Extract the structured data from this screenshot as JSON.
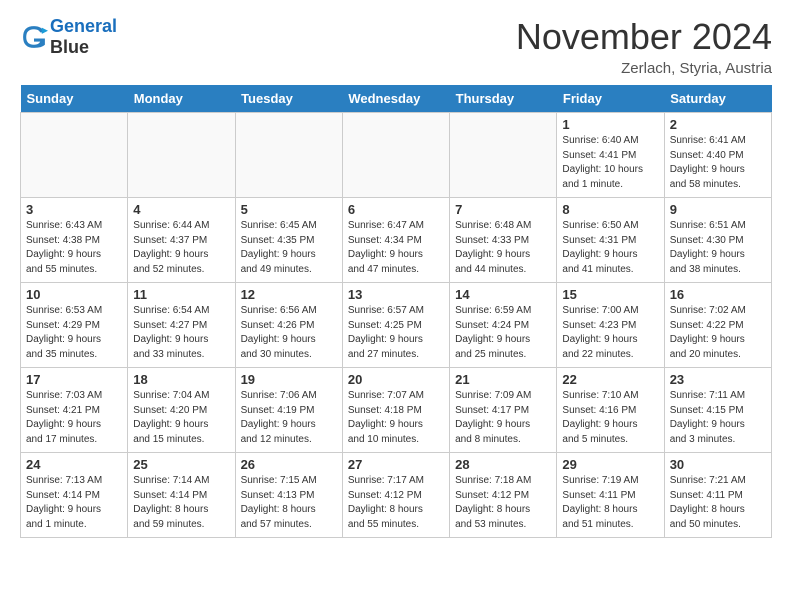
{
  "header": {
    "logo_line1": "General",
    "logo_line2": "Blue",
    "month_title": "November 2024",
    "location": "Zerlach, Styria, Austria"
  },
  "weekdays": [
    "Sunday",
    "Monday",
    "Tuesday",
    "Wednesday",
    "Thursday",
    "Friday",
    "Saturday"
  ],
  "weeks": [
    [
      {
        "day": "",
        "info": ""
      },
      {
        "day": "",
        "info": ""
      },
      {
        "day": "",
        "info": ""
      },
      {
        "day": "",
        "info": ""
      },
      {
        "day": "",
        "info": ""
      },
      {
        "day": "1",
        "info": "Sunrise: 6:40 AM\nSunset: 4:41 PM\nDaylight: 10 hours\nand 1 minute."
      },
      {
        "day": "2",
        "info": "Sunrise: 6:41 AM\nSunset: 4:40 PM\nDaylight: 9 hours\nand 58 minutes."
      }
    ],
    [
      {
        "day": "3",
        "info": "Sunrise: 6:43 AM\nSunset: 4:38 PM\nDaylight: 9 hours\nand 55 minutes."
      },
      {
        "day": "4",
        "info": "Sunrise: 6:44 AM\nSunset: 4:37 PM\nDaylight: 9 hours\nand 52 minutes."
      },
      {
        "day": "5",
        "info": "Sunrise: 6:45 AM\nSunset: 4:35 PM\nDaylight: 9 hours\nand 49 minutes."
      },
      {
        "day": "6",
        "info": "Sunrise: 6:47 AM\nSunset: 4:34 PM\nDaylight: 9 hours\nand 47 minutes."
      },
      {
        "day": "7",
        "info": "Sunrise: 6:48 AM\nSunset: 4:33 PM\nDaylight: 9 hours\nand 44 minutes."
      },
      {
        "day": "8",
        "info": "Sunrise: 6:50 AM\nSunset: 4:31 PM\nDaylight: 9 hours\nand 41 minutes."
      },
      {
        "day": "9",
        "info": "Sunrise: 6:51 AM\nSunset: 4:30 PM\nDaylight: 9 hours\nand 38 minutes."
      }
    ],
    [
      {
        "day": "10",
        "info": "Sunrise: 6:53 AM\nSunset: 4:29 PM\nDaylight: 9 hours\nand 35 minutes."
      },
      {
        "day": "11",
        "info": "Sunrise: 6:54 AM\nSunset: 4:27 PM\nDaylight: 9 hours\nand 33 minutes."
      },
      {
        "day": "12",
        "info": "Sunrise: 6:56 AM\nSunset: 4:26 PM\nDaylight: 9 hours\nand 30 minutes."
      },
      {
        "day": "13",
        "info": "Sunrise: 6:57 AM\nSunset: 4:25 PM\nDaylight: 9 hours\nand 27 minutes."
      },
      {
        "day": "14",
        "info": "Sunrise: 6:59 AM\nSunset: 4:24 PM\nDaylight: 9 hours\nand 25 minutes."
      },
      {
        "day": "15",
        "info": "Sunrise: 7:00 AM\nSunset: 4:23 PM\nDaylight: 9 hours\nand 22 minutes."
      },
      {
        "day": "16",
        "info": "Sunrise: 7:02 AM\nSunset: 4:22 PM\nDaylight: 9 hours\nand 20 minutes."
      }
    ],
    [
      {
        "day": "17",
        "info": "Sunrise: 7:03 AM\nSunset: 4:21 PM\nDaylight: 9 hours\nand 17 minutes."
      },
      {
        "day": "18",
        "info": "Sunrise: 7:04 AM\nSunset: 4:20 PM\nDaylight: 9 hours\nand 15 minutes."
      },
      {
        "day": "19",
        "info": "Sunrise: 7:06 AM\nSunset: 4:19 PM\nDaylight: 9 hours\nand 12 minutes."
      },
      {
        "day": "20",
        "info": "Sunrise: 7:07 AM\nSunset: 4:18 PM\nDaylight: 9 hours\nand 10 minutes."
      },
      {
        "day": "21",
        "info": "Sunrise: 7:09 AM\nSunset: 4:17 PM\nDaylight: 9 hours\nand 8 minutes."
      },
      {
        "day": "22",
        "info": "Sunrise: 7:10 AM\nSunset: 4:16 PM\nDaylight: 9 hours\nand 5 minutes."
      },
      {
        "day": "23",
        "info": "Sunrise: 7:11 AM\nSunset: 4:15 PM\nDaylight: 9 hours\nand 3 minutes."
      }
    ],
    [
      {
        "day": "24",
        "info": "Sunrise: 7:13 AM\nSunset: 4:14 PM\nDaylight: 9 hours\nand 1 minute."
      },
      {
        "day": "25",
        "info": "Sunrise: 7:14 AM\nSunset: 4:14 PM\nDaylight: 8 hours\nand 59 minutes."
      },
      {
        "day": "26",
        "info": "Sunrise: 7:15 AM\nSunset: 4:13 PM\nDaylight: 8 hours\nand 57 minutes."
      },
      {
        "day": "27",
        "info": "Sunrise: 7:17 AM\nSunset: 4:12 PM\nDaylight: 8 hours\nand 55 minutes."
      },
      {
        "day": "28",
        "info": "Sunrise: 7:18 AM\nSunset: 4:12 PM\nDaylight: 8 hours\nand 53 minutes."
      },
      {
        "day": "29",
        "info": "Sunrise: 7:19 AM\nSunset: 4:11 PM\nDaylight: 8 hours\nand 51 minutes."
      },
      {
        "day": "30",
        "info": "Sunrise: 7:21 AM\nSunset: 4:11 PM\nDaylight: 8 hours\nand 50 minutes."
      }
    ]
  ]
}
